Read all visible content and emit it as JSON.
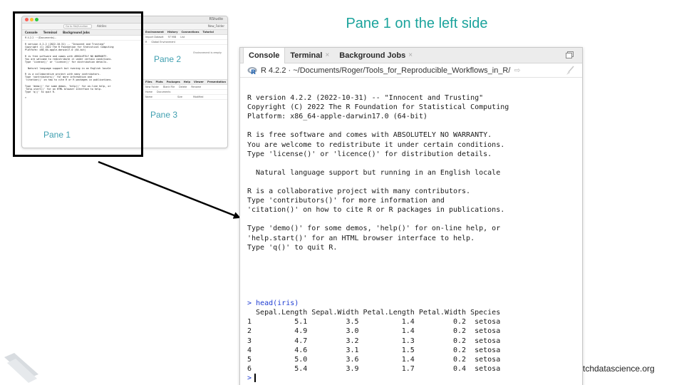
{
  "slide": {
    "title": "Pane 1 on the left side",
    "footer": "tchdatascience.org"
  },
  "thumbnail": {
    "window_title": "RStudio",
    "toolbar": {
      "goto_placeholder": "Go to file/function",
      "addins": "Addins",
      "project": "New_Folder"
    },
    "left_tabs": [
      "Console",
      "Terminal",
      "Background Jobs"
    ],
    "left_path": "R 4.2.2 · ~/Documents/...",
    "console_lines": [
      "R version 4.2.2 (2022-10-31) -- \"Innocent and Trusting\"",
      "Copyright (C) 2022 The R Foundation for Statistical Computing",
      "Platform: x86_64-apple-darwin17.0 (64-bit)",
      "",
      "R is free software and comes with ABSOLUTELY NO WARRANTY.",
      "You are welcome to redistribute it under certain conditions.",
      "Type 'license()' or 'licence()' for distribution details.",
      "",
      "  Natural language support but running in an English locale",
      "",
      "R is a collaborative project with many contributors.",
      "Type 'contributors()' for more information and",
      "'citation()' on how to cite R or R packages in publications.",
      "",
      "Type 'demo()' for some demos, 'help()' for on-line help, or",
      "'help.start()' for an HTML browser interface to help.",
      "Type 'q()' to quit R.",
      "",
      ">"
    ],
    "pane_labels": {
      "pane1": "Pane 1",
      "pane2": "Pane 2",
      "pane3": "Pane 3"
    },
    "right_top_tabs": [
      "Environment",
      "History",
      "Connections",
      "Tutorial"
    ],
    "right_top_sub": [
      "Import Dataset",
      "97 MiB",
      "List"
    ],
    "right_top_sub2": [
      "R",
      "Global Environment"
    ],
    "env_empty": "Environment is empty",
    "right_bottom_tabs": [
      "Files",
      "Plots",
      "Packages",
      "Help",
      "Viewer",
      "Presentation"
    ],
    "right_bottom_sub": [
      "New Folder",
      "Blank File",
      "Delete",
      "Rename"
    ],
    "right_bottom_path": [
      "Home",
      "Documents"
    ],
    "file_columns": [
      "Name",
      "Size",
      "Modified"
    ]
  },
  "console": {
    "tabs": [
      {
        "label": "Console",
        "closable": false
      },
      {
        "label": "Terminal",
        "closable": true
      },
      {
        "label": "Background Jobs",
        "closable": true
      }
    ],
    "path": "R 4.2.2 · ~/Documents/Roger/Tools_for_Reproducible_Workflows_in_R/",
    "startup_lines": [
      "",
      "R version 4.2.2 (2022-10-31) -- \"Innocent and Trusting\"",
      "Copyright (C) 2022 The R Foundation for Statistical Computing",
      "Platform: x86_64-apple-darwin17.0 (64-bit)",
      "",
      "R is free software and comes with ABSOLUTELY NO WARRANTY.",
      "You are welcome to redistribute it under certain conditions.",
      "Type 'license()' or 'licence()' for distribution details.",
      "",
      "  Natural language support but running in an English locale",
      "",
      "R is a collaborative project with many contributors.",
      "Type 'contributors()' for more information and",
      "'citation()' on how to cite R or R packages in publications.",
      "",
      "Type 'demo()' for some demos, 'help()' for on-line help, or",
      "'help.start()' for an HTML browser interface to help.",
      "Type 'q()' to quit R.",
      "",
      "",
      "",
      "",
      ""
    ],
    "command": "head(iris)",
    "prompt": ">",
    "output_header": "  Sepal.Length Sepal.Width Petal.Length Petal.Width Species",
    "output_rows": [
      "1          5.1         3.5          1.4         0.2  setosa",
      "2          4.9         3.0          1.4         0.2  setosa",
      "3          4.7         3.2          1.3         0.2  setosa",
      "4          4.6         3.1          1.5         0.2  setosa",
      "5          5.0         3.6          1.4         0.2  setosa",
      "6          5.4         3.9          1.7         0.4  setosa"
    ]
  },
  "colors": {
    "title_teal": "#1ba39c",
    "pane_label_blue": "#3f9fb0",
    "command_blue": "#1e3cd2"
  }
}
